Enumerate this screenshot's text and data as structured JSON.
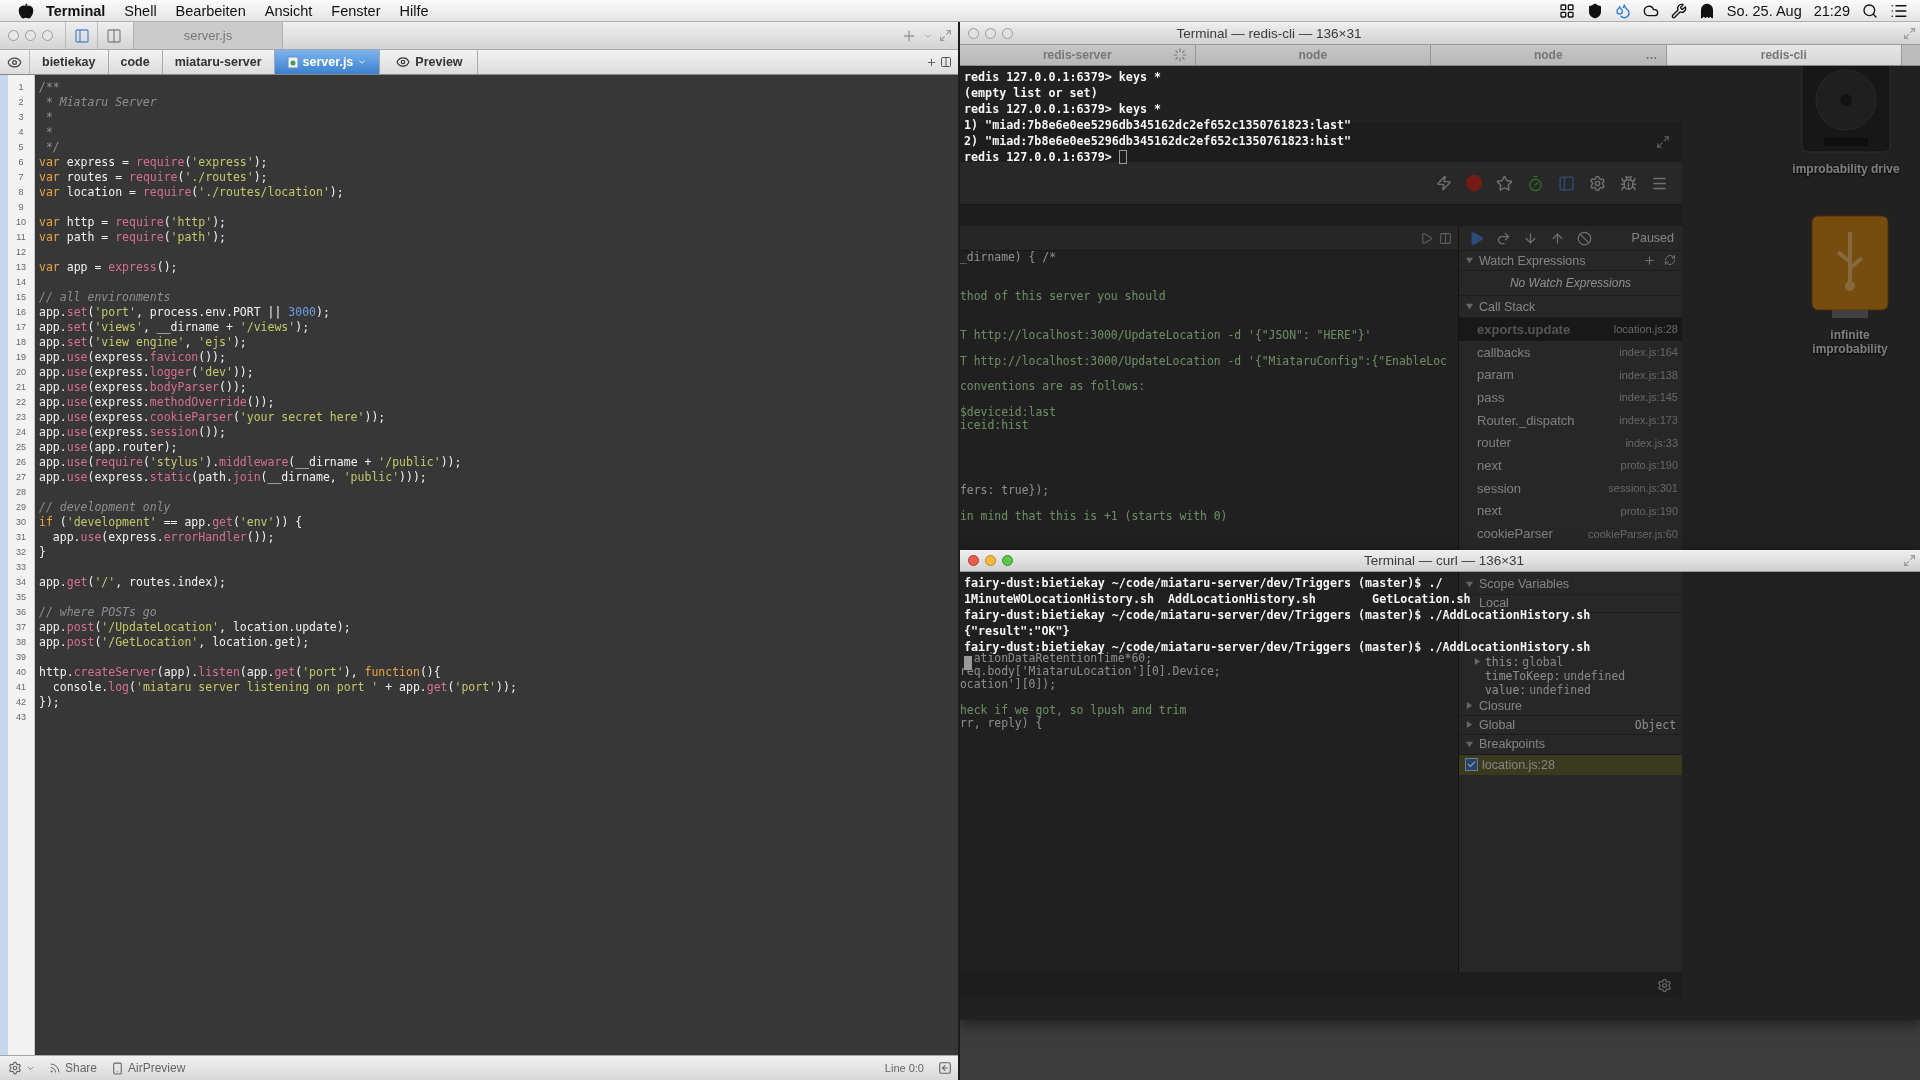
{
  "menu_bar": {
    "app": "Terminal",
    "items": [
      "Shell",
      "Bearbeiten",
      "Ansicht",
      "Fenster",
      "Hilfe"
    ],
    "date": "So. 25. Aug",
    "time": "21:29"
  },
  "editor": {
    "tab": "server.js",
    "breadcrumbs": [
      {
        "label": "bietiekay",
        "selected": false
      },
      {
        "label": "code",
        "selected": false
      },
      {
        "label": "miataru-server",
        "selected": false
      },
      {
        "label": "server.js",
        "selected": true
      }
    ],
    "preview": "Preview",
    "lines": [
      {
        "number": "1",
        "tokens": [
          {
            "kind": "cm",
            "text": "/**"
          }
        ]
      },
      {
        "number": "2",
        "tokens": [
          {
            "kind": "cm",
            "text": " * Miataru Server"
          }
        ]
      },
      {
        "number": "3",
        "tokens": [
          {
            "kind": "cm",
            "text": " *"
          }
        ]
      },
      {
        "number": "4",
        "tokens": [
          {
            "kind": "cm",
            "text": " *"
          }
        ]
      },
      {
        "number": "5",
        "tokens": [
          {
            "kind": "cm",
            "text": " */"
          }
        ]
      },
      {
        "number": "6",
        "tokens": [
          {
            "kind": "kw",
            "text": "var"
          },
          {
            "kind": "tx",
            "text": " express = "
          },
          {
            "kind": "fn",
            "text": "require"
          },
          {
            "kind": "tx",
            "text": "("
          },
          {
            "kind": "str",
            "text": "'express'"
          },
          {
            "kind": "tx",
            "text": ");"
          }
        ]
      },
      {
        "number": "7",
        "tokens": [
          {
            "kind": "kw",
            "text": "var"
          },
          {
            "kind": "tx",
            "text": " routes = "
          },
          {
            "kind": "fn",
            "text": "require"
          },
          {
            "kind": "tx",
            "text": "("
          },
          {
            "kind": "str",
            "text": "'./routes'"
          },
          {
            "kind": "tx",
            "text": ");"
          }
        ]
      },
      {
        "number": "8",
        "tokens": [
          {
            "kind": "kw",
            "text": "var"
          },
          {
            "kind": "tx",
            "text": " location = "
          },
          {
            "kind": "fn",
            "text": "require"
          },
          {
            "kind": "tx",
            "text": "("
          },
          {
            "kind": "str",
            "text": "'./routes/location'"
          },
          {
            "kind": "tx",
            "text": ");"
          }
        ]
      },
      {
        "number": "9"
      },
      {
        "number": "10",
        "tokens": [
          {
            "kind": "kw",
            "text": "var"
          },
          {
            "kind": "tx",
            "text": " http = "
          },
          {
            "kind": "fn",
            "text": "require"
          },
          {
            "kind": "tx",
            "text": "("
          },
          {
            "kind": "str",
            "text": "'http'"
          },
          {
            "kind": "tx",
            "text": ");"
          }
        ]
      },
      {
        "number": "11",
        "tokens": [
          {
            "kind": "kw",
            "text": "var"
          },
          {
            "kind": "tx",
            "text": " path = "
          },
          {
            "kind": "fn",
            "text": "require"
          },
          {
            "kind": "tx",
            "text": "("
          },
          {
            "kind": "str",
            "text": "'path'"
          },
          {
            "kind": "tx",
            "text": ");"
          }
        ]
      },
      {
        "number": "12"
      },
      {
        "number": "13",
        "tokens": [
          {
            "kind": "kw",
            "text": "var"
          },
          {
            "kind": "tx",
            "text": " app = "
          },
          {
            "kind": "fn",
            "text": "express"
          },
          {
            "kind": "tx",
            "text": "();"
          }
        ]
      },
      {
        "number": "14"
      },
      {
        "number": "15",
        "tokens": [
          {
            "kind": "cm",
            "text": "// all environments"
          }
        ]
      },
      {
        "number": "16",
        "tokens": [
          {
            "kind": "tx",
            "text": "app."
          },
          {
            "kind": "fn",
            "text": "set"
          },
          {
            "kind": "tx",
            "text": "("
          },
          {
            "kind": "str",
            "text": "'port'"
          },
          {
            "kind": "tx",
            "text": ", process.env.PORT || "
          },
          {
            "kind": "num",
            "text": "3000"
          },
          {
            "kind": "tx",
            "text": ");"
          }
        ]
      },
      {
        "number": "17",
        "tokens": [
          {
            "kind": "tx",
            "text": "app."
          },
          {
            "kind": "fn",
            "text": "set"
          },
          {
            "kind": "tx",
            "text": "("
          },
          {
            "kind": "str",
            "text": "'views'"
          },
          {
            "kind": "tx",
            "text": ", __dirname + "
          },
          {
            "kind": "str",
            "text": "'/views'"
          },
          {
            "kind": "tx",
            "text": ");"
          }
        ]
      },
      {
        "number": "18",
        "tokens": [
          {
            "kind": "tx",
            "text": "app."
          },
          {
            "kind": "fn",
            "text": "set"
          },
          {
            "kind": "tx",
            "text": "("
          },
          {
            "kind": "str",
            "text": "'view engine'"
          },
          {
            "kind": "tx",
            "text": ", "
          },
          {
            "kind": "str",
            "text": "'ejs'"
          },
          {
            "kind": "tx",
            "text": ");"
          }
        ]
      },
      {
        "number": "19",
        "tokens": [
          {
            "kind": "tx",
            "text": "app."
          },
          {
            "kind": "fn",
            "text": "use"
          },
          {
            "kind": "tx",
            "text": "(express."
          },
          {
            "kind": "fn",
            "text": "favicon"
          },
          {
            "kind": "tx",
            "text": "());"
          }
        ]
      },
      {
        "number": "20",
        "tokens": [
          {
            "kind": "tx",
            "text": "app."
          },
          {
            "kind": "fn",
            "text": "use"
          },
          {
            "kind": "tx",
            "text": "(express."
          },
          {
            "kind": "fn",
            "text": "logger"
          },
          {
            "kind": "tx",
            "text": "("
          },
          {
            "kind": "str",
            "text": "'dev'"
          },
          {
            "kind": "tx",
            "text": "));"
          }
        ]
      },
      {
        "number": "21",
        "tokens": [
          {
            "kind": "tx",
            "text": "app."
          },
          {
            "kind": "fn",
            "text": "use"
          },
          {
            "kind": "tx",
            "text": "(express."
          },
          {
            "kind": "fn",
            "text": "bodyParser"
          },
          {
            "kind": "tx",
            "text": "());"
          }
        ]
      },
      {
        "number": "22",
        "tokens": [
          {
            "kind": "tx",
            "text": "app."
          },
          {
            "kind": "fn",
            "text": "use"
          },
          {
            "kind": "tx",
            "text": "(express."
          },
          {
            "kind": "fn",
            "text": "methodOverride"
          },
          {
            "kind": "tx",
            "text": "());"
          }
        ]
      },
      {
        "number": "23",
        "tokens": [
          {
            "kind": "tx",
            "text": "app."
          },
          {
            "kind": "fn",
            "text": "use"
          },
          {
            "kind": "tx",
            "text": "(express."
          },
          {
            "kind": "fn",
            "text": "cookieParser"
          },
          {
            "kind": "tx",
            "text": "("
          },
          {
            "kind": "str",
            "text": "'your secret here'"
          },
          {
            "kind": "tx",
            "text": "));"
          }
        ]
      },
      {
        "number": "24",
        "tokens": [
          {
            "kind": "tx",
            "text": "app."
          },
          {
            "kind": "fn",
            "text": "use"
          },
          {
            "kind": "tx",
            "text": "(express."
          },
          {
            "kind": "fn",
            "text": "session"
          },
          {
            "kind": "tx",
            "text": "());"
          }
        ]
      },
      {
        "number": "25",
        "tokens": [
          {
            "kind": "tx",
            "text": "app."
          },
          {
            "kind": "fn",
            "text": "use"
          },
          {
            "kind": "tx",
            "text": "(app.router);"
          }
        ]
      },
      {
        "number": "26",
        "tokens": [
          {
            "kind": "tx",
            "text": "app."
          },
          {
            "kind": "fn",
            "text": "use"
          },
          {
            "kind": "tx",
            "text": "("
          },
          {
            "kind": "fn",
            "text": "require"
          },
          {
            "kind": "tx",
            "text": "("
          },
          {
            "kind": "str",
            "text": "'stylus'"
          },
          {
            "kind": "tx",
            "text": ")."
          },
          {
            "kind": "fn",
            "text": "middleware"
          },
          {
            "kind": "tx",
            "text": "(__dirname + "
          },
          {
            "kind": "str",
            "text": "'/public'"
          },
          {
            "kind": "tx",
            "text": "));"
          }
        ]
      },
      {
        "number": "27",
        "tokens": [
          {
            "kind": "tx",
            "text": "app."
          },
          {
            "kind": "fn",
            "text": "use"
          },
          {
            "kind": "tx",
            "text": "(express."
          },
          {
            "kind": "fn",
            "text": "static"
          },
          {
            "kind": "tx",
            "text": "(path."
          },
          {
            "kind": "fn",
            "text": "join"
          },
          {
            "kind": "tx",
            "text": "(__dirname, "
          },
          {
            "kind": "str",
            "text": "'public'"
          },
          {
            "kind": "tx",
            "text": ")));"
          }
        ]
      },
      {
        "number": "28"
      },
      {
        "number": "29",
        "tokens": [
          {
            "kind": "cm",
            "text": "// development only"
          }
        ]
      },
      {
        "number": "30",
        "tokens": [
          {
            "kind": "kw",
            "text": "if"
          },
          {
            "kind": "tx",
            "text": " ("
          },
          {
            "kind": "str",
            "text": "'development'"
          },
          {
            "kind": "tx",
            "text": " == app."
          },
          {
            "kind": "fn",
            "text": "get"
          },
          {
            "kind": "tx",
            "text": "("
          },
          {
            "kind": "str",
            "text": "'env'"
          },
          {
            "kind": "tx",
            "text": ")) {"
          }
        ]
      },
      {
        "number": "31",
        "tokens": [
          {
            "kind": "tx",
            "text": "  app."
          },
          {
            "kind": "fn",
            "text": "use"
          },
          {
            "kind": "tx",
            "text": "(express."
          },
          {
            "kind": "fn",
            "text": "errorHandler"
          },
          {
            "kind": "tx",
            "text": "());"
          }
        ]
      },
      {
        "number": "32",
        "tokens": [
          {
            "kind": "tx",
            "text": "}"
          }
        ]
      },
      {
        "number": "33"
      },
      {
        "number": "34",
        "tokens": [
          {
            "kind": "tx",
            "text": "app."
          },
          {
            "kind": "fn",
            "text": "get"
          },
          {
            "kind": "tx",
            "text": "("
          },
          {
            "kind": "str",
            "text": "'/'"
          },
          {
            "kind": "tx",
            "text": ", routes.index);"
          }
        ]
      },
      {
        "number": "35"
      },
      {
        "number": "36",
        "tokens": [
          {
            "kind": "cm",
            "text": "// where POSTs go"
          }
        ]
      },
      {
        "number": "37",
        "tokens": [
          {
            "kind": "tx",
            "text": "app."
          },
          {
            "kind": "fn",
            "text": "post"
          },
          {
            "kind": "tx",
            "text": "("
          },
          {
            "kind": "str",
            "text": "'/UpdateLocation'"
          },
          {
            "kind": "tx",
            "text": ", location.update);"
          }
        ]
      },
      {
        "number": "38",
        "tokens": [
          {
            "kind": "tx",
            "text": "app."
          },
          {
            "kind": "fn",
            "text": "post"
          },
          {
            "kind": "tx",
            "text": "("
          },
          {
            "kind": "str",
            "text": "'/GetLocation'"
          },
          {
            "kind": "tx",
            "text": ", location.get);"
          }
        ]
      },
      {
        "number": "39"
      },
      {
        "number": "40",
        "tokens": [
          {
            "kind": "tx",
            "text": "http."
          },
          {
            "kind": "fn",
            "text": "createServer"
          },
          {
            "kind": "tx",
            "text": "(app)."
          },
          {
            "kind": "fn",
            "text": "listen"
          },
          {
            "kind": "tx",
            "text": "(app."
          },
          {
            "kind": "fn",
            "text": "get"
          },
          {
            "kind": "tx",
            "text": "("
          },
          {
            "kind": "str",
            "text": "'port'"
          },
          {
            "kind": "tx",
            "text": "), "
          },
          {
            "kind": "kw",
            "text": "function"
          },
          {
            "kind": "tx",
            "text": "(){"
          }
        ]
      },
      {
        "number": "41",
        "tokens": [
          {
            "kind": "tx",
            "text": "  console."
          },
          {
            "kind": "fn",
            "text": "log"
          },
          {
            "kind": "tx",
            "text": "("
          },
          {
            "kind": "str",
            "text": "'miataru server listening on port '"
          },
          {
            "kind": "tx",
            "text": " + app."
          },
          {
            "kind": "fn",
            "text": "get"
          },
          {
            "kind": "tx",
            "text": "("
          },
          {
            "kind": "str",
            "text": "'port'"
          },
          {
            "kind": "tx",
            "text": "));"
          }
        ]
      },
      {
        "number": "42",
        "tokens": [
          {
            "kind": "tx",
            "text": "});"
          }
        ]
      },
      {
        "number": "43"
      }
    ],
    "status": {
      "share": "Share",
      "air_preview": "AirPreview",
      "position": "Line 0:0"
    }
  },
  "debugger": {
    "state": "Paused",
    "source_lines": [
      {
        "kind": "code",
        "text": "_dirname) { /*"
      },
      {
        "kind": "blank"
      },
      {
        "kind": "blank"
      },
      {
        "kind": "comment",
        "text": "thod of this server you should"
      },
      {
        "kind": "blank"
      },
      {
        "kind": "blank"
      },
      {
        "kind": "comment",
        "text": "T http://localhost:3000/UpdateLocation -d '{\"JSON\": \"HERE\"}'"
      },
      {
        "kind": "blank"
      },
      {
        "kind": "comment",
        "text": "T http://localhost:3000/UpdateLocation -d '{\"MiataruConfig\":{\"EnableLoc"
      },
      {
        "kind": "blank"
      },
      {
        "kind": "comment",
        "text": "conventions are as follows:"
      },
      {
        "kind": "blank"
      },
      {
        "kind": "comment",
        "text": "$deviceid:last"
      },
      {
        "kind": "comment",
        "text": "iceid:hist"
      },
      {
        "kind": "blank"
      },
      {
        "kind": "blank"
      },
      {
        "kind": "blank"
      },
      {
        "kind": "blank"
      },
      {
        "kind": "code",
        "text": "fers: true});"
      },
      {
        "kind": "blank"
      },
      {
        "kind": "comment",
        "text": "in mind that this is +1 (starts with 0)"
      },
      {
        "kind": "blank"
      },
      {
        "kind": "blank"
      },
      {
        "kind": "blank"
      },
      {
        "kind": "blank"
      },
      {
        "kind": "blank"
      },
      {
        "kind": "blank"
      },
      {
        "kind": "blank"
      },
      {
        "kind": "blank"
      },
      {
        "kind": "blank"
      },
      {
        "kind": "blank"
      },
      {
        "kind": "code",
        "text": "  ationDataRetentionTime*60;"
      },
      {
        "kind": "code",
        "text": "req.body['MiataruLocation'][0].Device;"
      },
      {
        "kind": "code",
        "text": "ocation'][0]);"
      },
      {
        "kind": "blank"
      },
      {
        "kind": "comment",
        "text": "heck if we got, so lpush and trim"
      },
      {
        "kind": "code",
        "text": "rr, reply) {"
      }
    ],
    "watch_title": "Watch Expressions",
    "watch_empty": "No Watch Expressions",
    "call_stack_title": "Call Stack",
    "call_stack": [
      {
        "name": "exports.update",
        "file": "location.js:28",
        "selected": true
      },
      {
        "name": "callbacks",
        "file": "index.js:164",
        "selected": false
      },
      {
        "name": "param",
        "file": "index.js:138",
        "selected": false
      },
      {
        "name": "pass",
        "file": "index.js:145",
        "selected": false
      },
      {
        "name": "Router._dispatch",
        "file": "index.js:173",
        "selected": false
      },
      {
        "name": "router",
        "file": "index.js:33",
        "selected": false
      },
      {
        "name": "next",
        "file": "proto.js:190",
        "selected": false
      },
      {
        "name": "session",
        "file": "session.js:301",
        "selected": false
      },
      {
        "name": "next",
        "file": "proto.js:190",
        "selected": false
      },
      {
        "name": "cookieParser",
        "file": "cookieParser.js:60",
        "selected": false
      }
    ],
    "scope_title": "Scope Variables",
    "local_title": "Local",
    "scope": [
      {
        "kind": "expandable",
        "name": "this:",
        "value": "global"
      },
      {
        "kind": "plain",
        "name": "timeToKeep:",
        "value": "undefined"
      },
      {
        "kind": "plain",
        "name": "value:",
        "value": "undefined"
      },
      {
        "kind": "section",
        "name": "Closure"
      },
      {
        "kind": "section",
        "name": "Global",
        "value": "Object"
      }
    ],
    "breakpoints_title": "Breakpoints",
    "breakpoints": [
      {
        "label": "location.js:28",
        "checked": true
      }
    ]
  },
  "redis_terminal": {
    "title": "Terminal — redis-cli — 136×31",
    "tabs": [
      {
        "label": "redis-server",
        "selected": false,
        "busy": true
      },
      {
        "label": "node",
        "selected": false,
        "busy": false
      },
      {
        "label": "node",
        "selected": false,
        "busy": false,
        "more": "…"
      },
      {
        "label": "redis-cli",
        "selected": true,
        "busy": false
      }
    ],
    "lines": [
      {
        "text": "redis 127.0.0.1:6379> keys *",
        "cursor": false
      },
      {
        "text": "(empty list or set)",
        "cursor": false
      },
      {
        "text": "redis 127.0.0.1:6379> keys *",
        "cursor": false
      },
      {
        "text": "1) \"miad:7b8e6e0ee5296db345162dc2ef652c1350761823:last\"",
        "cursor": false
      },
      {
        "text": "2) \"miad:7b8e6e0ee5296db345162dc2ef652c1350761823:hist\"",
        "cursor": false
      },
      {
        "text": "redis 127.0.0.1:6379> ",
        "cursor": true
      }
    ]
  },
  "curl_terminal": {
    "title": "Terminal — curl — 136×31",
    "lines": [
      {
        "text": "fairy-dust:bietiekay ~/code/miataru-server/dev/Triggers (master)$ ./",
        "cursor": false
      },
      {
        "text": "1MinuteWOLocationHistory.sh  AddLocationHistory.sh        GetLocation.sh",
        "cursor": false
      },
      {
        "text": "fairy-dust:bietiekay ~/code/miataru-server/dev/Triggers (master)$ ./AddLocationHistory.sh",
        "cursor": false
      },
      {
        "text": "{\"result\":\"OK\"}",
        "cursor": false
      },
      {
        "text": "fairy-dust:bietiekay ~/code/miataru-server/dev/Triggers (master)$ ./AddLocationHistory.sh",
        "cursor": false
      },
      {
        "cursor": true
      }
    ]
  },
  "desktop_icons": [
    {
      "kind": "disk",
      "label": "improbability drive"
    },
    {
      "kind": "usb",
      "label": "infinite improbability"
    }
  ]
}
